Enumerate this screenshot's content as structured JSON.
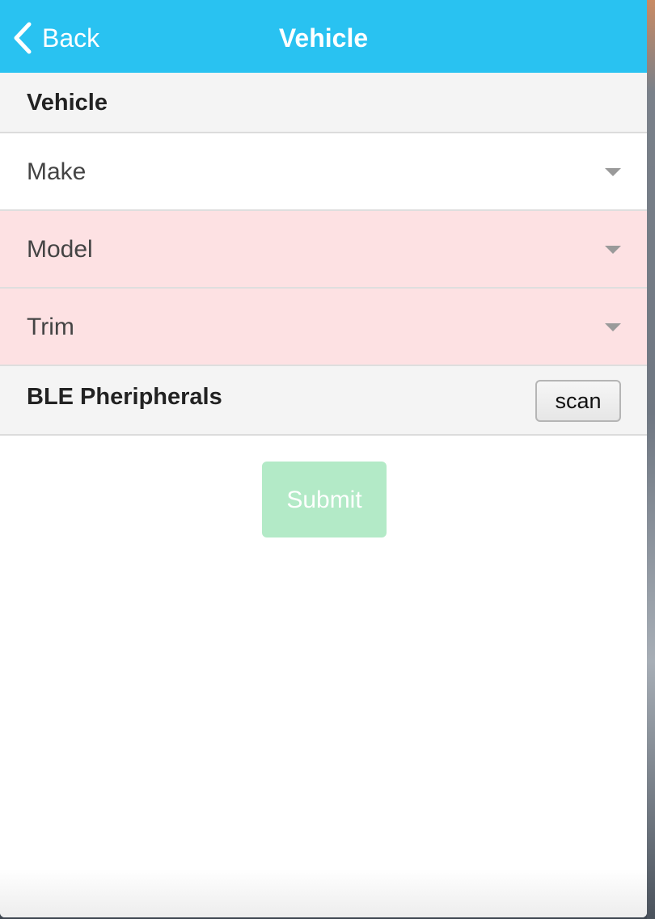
{
  "navbar": {
    "back_label": "Back",
    "title": "Vehicle",
    "color": "#29c2f1"
  },
  "vehicle_section": {
    "header": "Vehicle",
    "fields": [
      {
        "label": "Make",
        "state": "normal"
      },
      {
        "label": "Model",
        "state": "invalid"
      },
      {
        "label": "Trim",
        "state": "invalid"
      }
    ],
    "invalid_color": "#fde1e3"
  },
  "ble_section": {
    "header": "BLE Pheripherals",
    "scan_label": "scan"
  },
  "form": {
    "submit_label": "Submit",
    "submit_enabled": false,
    "submit_color": "#b3eac7"
  }
}
